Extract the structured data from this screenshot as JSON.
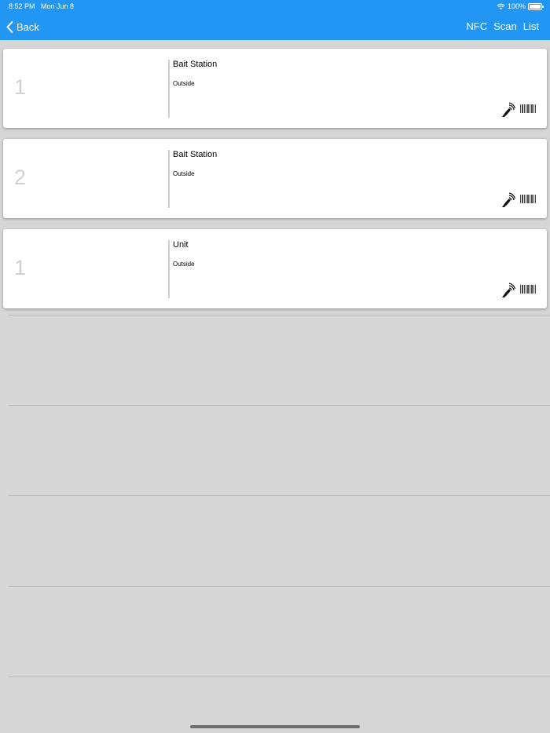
{
  "status_bar": {
    "time": "8:52 PM",
    "date": "Mon Jun 8",
    "battery": "100%",
    "icons": [
      "wifi-icon",
      "battery-icon"
    ]
  },
  "nav": {
    "back_label": "Back",
    "actions": [
      "NFC",
      "Scan",
      "List"
    ]
  },
  "items": [
    {
      "number": "1",
      "title": "Bait Station",
      "location": "Outside"
    },
    {
      "number": "2",
      "title": "Bait Station",
      "location": "Outside"
    },
    {
      "number": "1",
      "title": "Unit",
      "location": "Outside"
    }
  ],
  "colors": {
    "header_bg": "#2196f3",
    "page_bg": "#d6d6d6",
    "card_bg": "#ffffff",
    "number_text": "#d0d0d0"
  }
}
